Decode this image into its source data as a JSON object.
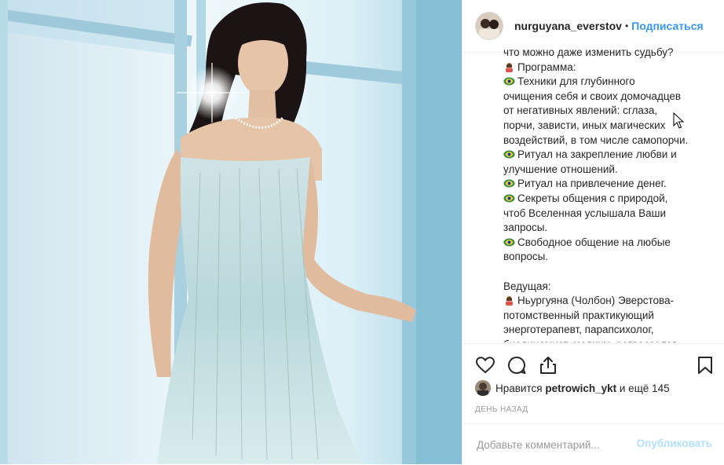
{
  "post": {
    "image_alt": "Woman in a strapless sequined dress by a window",
    "username": "nurguyana_everstov",
    "separator": "•",
    "follow_label": "Подписаться"
  },
  "caption_lines": [
    {
      "emoji": "",
      "text": "что можно даже изменить судьбу?"
    },
    {
      "emoji": "woman-icon",
      "text": "Программа:"
    },
    {
      "emoji": "eye-icon",
      "text": "Техники для глубинного"
    },
    {
      "emoji": "",
      "text": "очищения себя и своих домочадцев"
    },
    {
      "emoji": "",
      "text": "от негативных явлений: сглаза,"
    },
    {
      "emoji": "",
      "text": "порчи, зависти, иных магических"
    },
    {
      "emoji": "",
      "text": "воздействий, в том числе самопорчи."
    },
    {
      "emoji": "eye-icon",
      "text": "Ритуал на закрепление любви и"
    },
    {
      "emoji": "",
      "text": "улучшение отношений."
    },
    {
      "emoji": "eye-icon",
      "text": "Ритуал на привлечение денег."
    },
    {
      "emoji": "eye-icon",
      "text": "Секреты общения с природой,"
    },
    {
      "emoji": "",
      "text": "чтоб Вселенная услышала Ваши"
    },
    {
      "emoji": "",
      "text": "запросы."
    },
    {
      "emoji": "eye-icon",
      "text": "Свободное общение на любые"
    },
    {
      "emoji": "",
      "text": "вопросы."
    },
    {
      "emoji": "",
      "text": ""
    },
    {
      "emoji": "",
      "text": "Ведущая:"
    },
    {
      "emoji": "woman-icon",
      "text": "Ньургуяна (Чолбон) Эверстова-"
    },
    {
      "emoji": "",
      "text": "потомственный практикующий"
    },
    {
      "emoji": "",
      "text": "энерготерапевт, парапсихолог,"
    },
    {
      "emoji": "",
      "text": "биодинамист, медиум, регрессолог."
    }
  ],
  "likes": {
    "prefix": "Нравится",
    "user": "petrowich_ykt",
    "suffix": "и ещё 145"
  },
  "timestamp": "ДЕНЬ НАЗАД",
  "comment": {
    "placeholder": "Добавьте комментарий...",
    "post_label": "Опубликовать"
  },
  "colors": {
    "link_blue": "#3897f0",
    "post_disabled": "#b2dffc",
    "muted": "#999999"
  }
}
